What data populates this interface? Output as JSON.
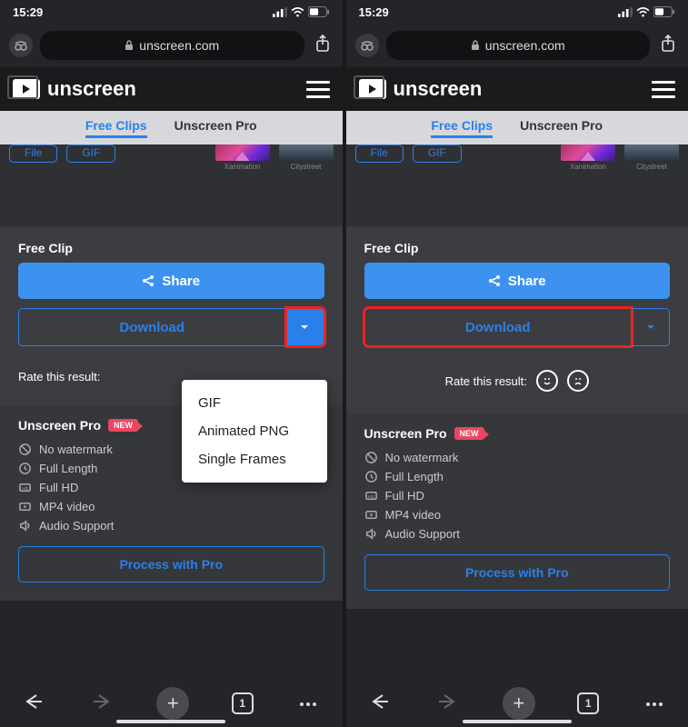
{
  "status": {
    "time": "15:29"
  },
  "browser": {
    "url": "unscreen.com",
    "tab_count": "1"
  },
  "header": {
    "brand": "unscreen"
  },
  "tabs": {
    "free": "Free Clips",
    "pro": "Unscreen Pro"
  },
  "chips": {
    "file": "File",
    "gif": "GIF"
  },
  "thumbs": {
    "xanimation": "Xanimation",
    "citystreet": "Citystreet"
  },
  "free_panel": {
    "title": "Free Clip",
    "share": "Share",
    "download": "Download",
    "rate_label": "Rate this result:"
  },
  "dropdown": {
    "gif": "GIF",
    "apng": "Animated PNG",
    "frames": "Single Frames"
  },
  "pro_panel": {
    "title": "Unscreen Pro",
    "badge": "NEW",
    "features": {
      "no_watermark": "No watermark",
      "full_length": "Full Length",
      "full_hd": "Full HD",
      "mp4": "MP4 video",
      "audio": "Audio Support"
    },
    "cta": "Process with Pro"
  }
}
